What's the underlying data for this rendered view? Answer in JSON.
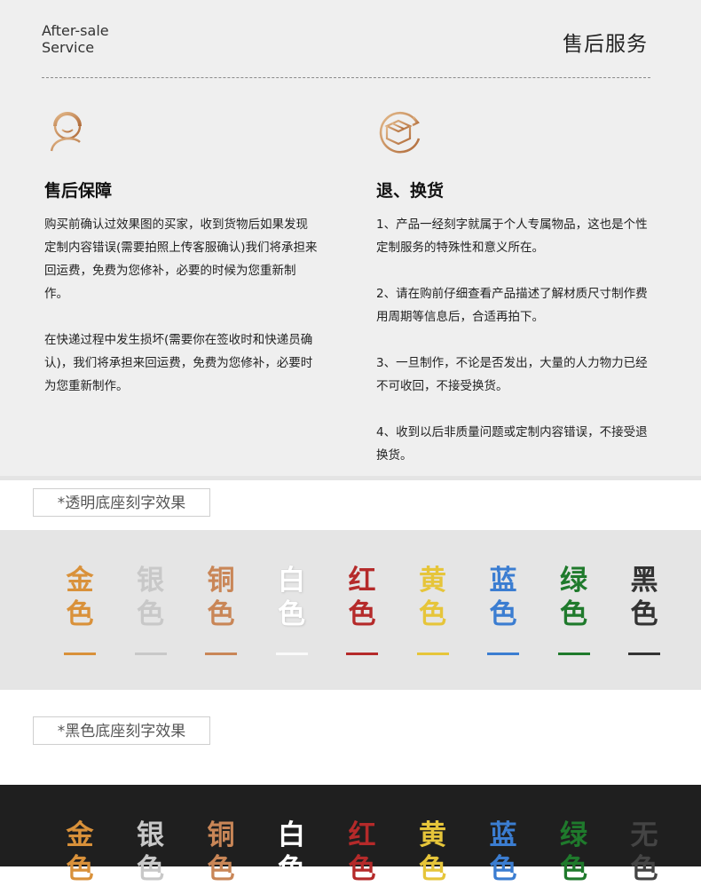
{
  "header": {
    "brand_en_line1": "After-sale",
    "brand_en_line2": "Service",
    "title_cn": "售后服务"
  },
  "left_col": {
    "icon": "customer-service-person-plus-icon",
    "title": "售后保障",
    "paragraphs": [
      "购买前确认过效果图的买家，收到货物后如果发现定制内容错误(需要拍照上传客服确认)我们将承担来回运费，免费为您修补，必要的时候为您重新制作。",
      "在快递过程中发生损坏(需要你在签收时和快递员确认)，我们将承担来回运费，免费为您修补，必要时为您重新制作。"
    ]
  },
  "right_col": {
    "icon": "box-return-icon",
    "title": "退、换货",
    "paragraphs": [
      "1、产品一经刻字就属于个人专属物品，这也是个性定制服务的特殊性和意义所在。",
      "2、请在购前仔细查看产品描述了解材质尺寸制作费用周期等信息后，合适再拍下。",
      "3、一旦制作，不论是否发出，大量的人力物力已经不可收回，不接受换货。",
      "4、收到以后非质量问题或定制内容错误，不接受退换货。"
    ]
  },
  "section_transparent": {
    "label": "*透明底座刻字效果",
    "swatches": [
      {
        "top": "金",
        "bottom": "色",
        "color": "#d9913a"
      },
      {
        "top": "银",
        "bottom": "色",
        "color": "#c8c8c8"
      },
      {
        "top": "铜",
        "bottom": "色",
        "color": "#c98657"
      },
      {
        "top": "白",
        "bottom": "色",
        "color": "#ffffff"
      },
      {
        "top": "红",
        "bottom": "色",
        "color": "#b52a2a"
      },
      {
        "top": "黄",
        "bottom": "色",
        "color": "#e6c53a"
      },
      {
        "top": "蓝",
        "bottom": "色",
        "color": "#3b7dd1"
      },
      {
        "top": "绿",
        "bottom": "色",
        "color": "#1f7a2c"
      },
      {
        "top": "黑",
        "bottom": "色",
        "color": "#333333"
      }
    ]
  },
  "section_black": {
    "label": "*黑色底座刻字效果",
    "swatches": [
      {
        "top": "金",
        "bottom": "色",
        "color": "#d9913a"
      },
      {
        "top": "银",
        "bottom": "色",
        "color": "#c8c8c8"
      },
      {
        "top": "铜",
        "bottom": "色",
        "color": "#c98657"
      },
      {
        "top": "白",
        "bottom": "色",
        "color": "#ffffff"
      },
      {
        "top": "红",
        "bottom": "色",
        "color": "#b52a2a"
      },
      {
        "top": "黄",
        "bottom": "色",
        "color": "#e6c53a"
      },
      {
        "top": "蓝",
        "bottom": "色",
        "color": "#3b7dd1"
      },
      {
        "top": "绿",
        "bottom": "色",
        "color": "#1f7a2c"
      },
      {
        "top": "无",
        "bottom": "色",
        "color": "#444444"
      }
    ]
  },
  "colors": {
    "accent_copper": "#c98a55",
    "panel_bg": "#efefef",
    "dark_band": "#1f1f1f"
  }
}
